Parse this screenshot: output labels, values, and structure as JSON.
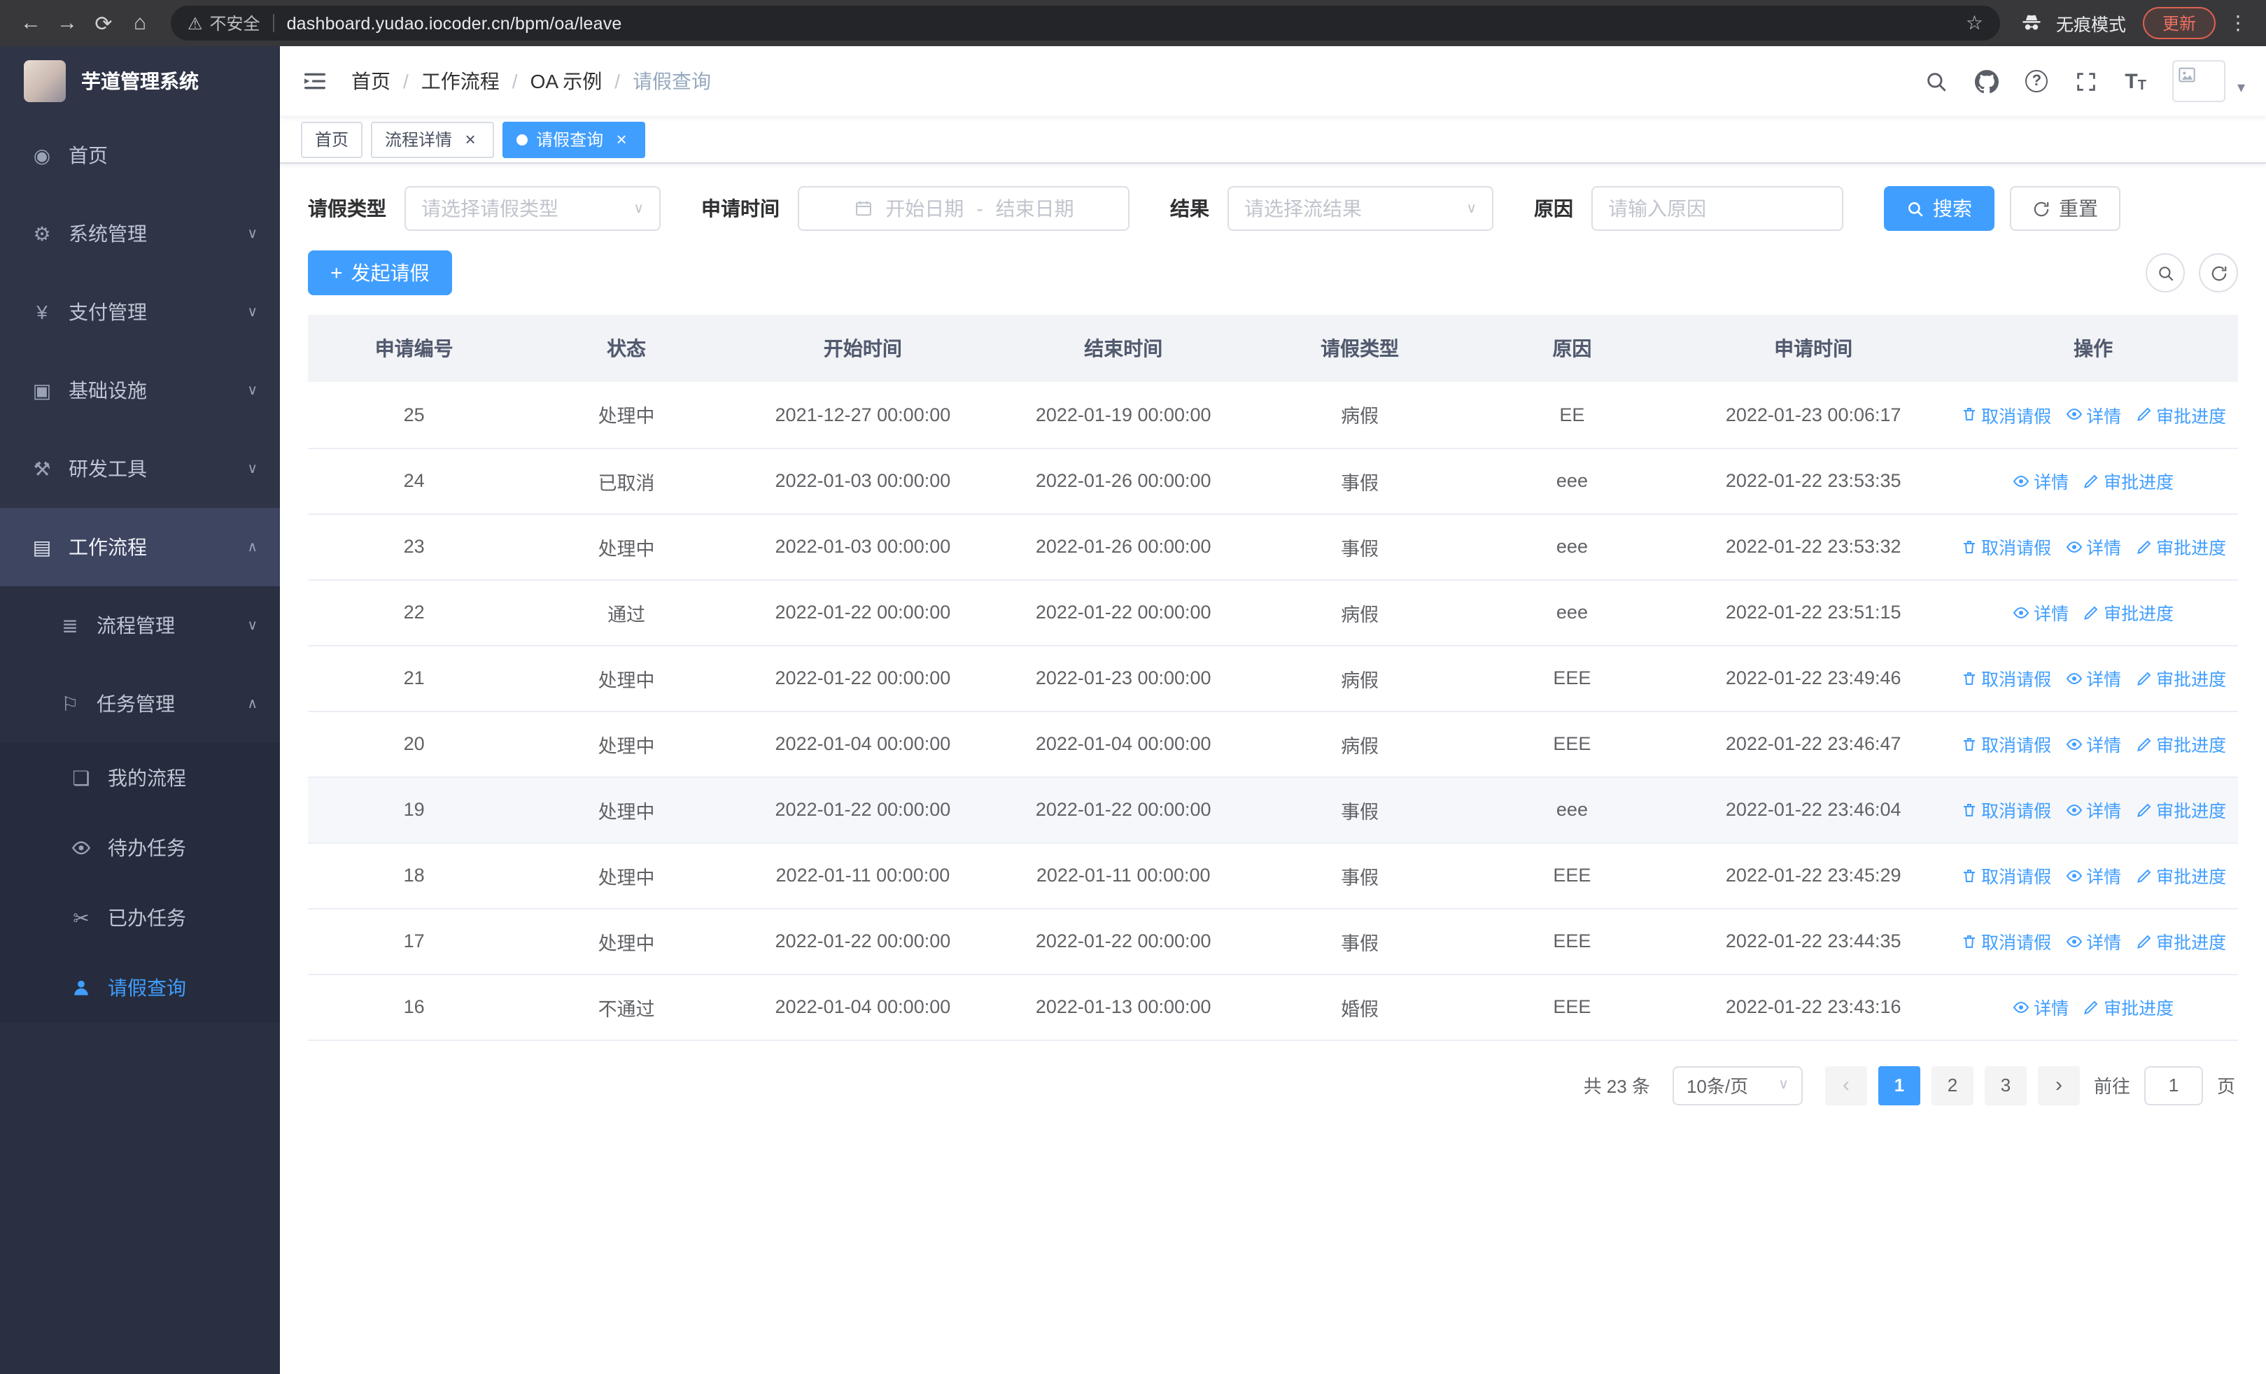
{
  "colors": {
    "accent": "#409eff",
    "sidebar_bg": "#2f3447",
    "update_red": "#e0604f"
  },
  "browser": {
    "security_label": "不安全",
    "url": "dashboard.yudao.iocoder.cn/bpm/oa/leave",
    "incognito_label": "无痕模式",
    "update_label": "更新"
  },
  "sidebar": {
    "title": "芋道管理系统",
    "menu": [
      {
        "id": "home",
        "label": "首页",
        "icon": "dashboard-icon",
        "level": 1
      },
      {
        "id": "system-management",
        "label": "系统管理",
        "icon": "gear-icon",
        "level": 1,
        "arrow": "down"
      },
      {
        "id": "payment-management",
        "label": "支付管理",
        "icon": "yen-icon",
        "level": 1,
        "arrow": "down"
      },
      {
        "id": "infrastructure",
        "label": "基础设施",
        "icon": "infra-icon",
        "level": 1,
        "arrow": "down"
      },
      {
        "id": "dev-tools",
        "label": "研发工具",
        "icon": "tools-icon",
        "level": 1,
        "arrow": "down"
      },
      {
        "id": "workflow",
        "label": "工作流程",
        "icon": "workflow-icon",
        "level": 1,
        "arrow": "up",
        "highlight": true
      },
      {
        "id": "process-management",
        "label": "流程管理",
        "icon": "process-icon",
        "level": 2,
        "arrow": "down"
      },
      {
        "id": "task-management",
        "label": "任务管理",
        "icon": "task-icon",
        "level": 2,
        "arrow": "up"
      },
      {
        "id": "my-process",
        "label": "我的流程",
        "icon": "chat-icon",
        "level": 3
      },
      {
        "id": "todo-tasks",
        "label": "待办任务",
        "icon": "eye-icon",
        "level": 3
      },
      {
        "id": "done-tasks",
        "label": "已办任务",
        "icon": "scissors-icon",
        "level": 3
      },
      {
        "id": "leave-query",
        "label": "请假查询",
        "icon": "user-icon",
        "level": 3,
        "active": true
      }
    ]
  },
  "navbar": {
    "breadcrumb": [
      "首页",
      "工作流程",
      "OA 示例",
      "请假查询"
    ]
  },
  "tabs": [
    {
      "id": "home",
      "label": "首页",
      "closable": false,
      "active": false
    },
    {
      "id": "process-detail",
      "label": "流程详情",
      "closable": true,
      "active": false
    },
    {
      "id": "leave-query",
      "label": "请假查询",
      "closable": true,
      "active": true
    }
  ],
  "filters": {
    "leave_type_label": "请假类型",
    "leave_type_placeholder": "请选择请假类型",
    "apply_time_label": "申请时间",
    "start_date_placeholder": "开始日期",
    "date_separator": "-",
    "end_date_placeholder": "结束日期",
    "result_label": "结果",
    "result_placeholder": "请选择流结果",
    "reason_label": "原因",
    "reason_placeholder": "请输入原因",
    "search_button": "搜索",
    "reset_button": "重置"
  },
  "toolbar": {
    "create_button": "发起请假"
  },
  "table": {
    "columns": [
      "申请编号",
      "状态",
      "开始时间",
      "结束时间",
      "请假类型",
      "原因",
      "申请时间",
      "操作"
    ],
    "action_labels": {
      "cancel": "取消请假",
      "detail": "详情",
      "progress": "审批进度"
    },
    "rows": [
      {
        "id": "25",
        "status": "处理中",
        "start": "2021-12-27 00:00:00",
        "end": "2022-01-19 00:00:00",
        "type": "病假",
        "reason": "EE",
        "applied": "2022-01-23 00:06:17",
        "actions": [
          "cancel",
          "detail",
          "progress"
        ]
      },
      {
        "id": "24",
        "status": "已取消",
        "start": "2022-01-03 00:00:00",
        "end": "2022-01-26 00:00:00",
        "type": "事假",
        "reason": "eee",
        "applied": "2022-01-22 23:53:35",
        "actions": [
          "detail",
          "progress"
        ]
      },
      {
        "id": "23",
        "status": "处理中",
        "start": "2022-01-03 00:00:00",
        "end": "2022-01-26 00:00:00",
        "type": "事假",
        "reason": "eee",
        "applied": "2022-01-22 23:53:32",
        "actions": [
          "cancel",
          "detail",
          "progress"
        ]
      },
      {
        "id": "22",
        "status": "通过",
        "start": "2022-01-22 00:00:00",
        "end": "2022-01-22 00:00:00",
        "type": "病假",
        "reason": "eee",
        "applied": "2022-01-22 23:51:15",
        "actions": [
          "detail",
          "progress"
        ]
      },
      {
        "id": "21",
        "status": "处理中",
        "start": "2022-01-22 00:00:00",
        "end": "2022-01-23 00:00:00",
        "type": "病假",
        "reason": "EEE",
        "applied": "2022-01-22 23:49:46",
        "actions": [
          "cancel",
          "detail",
          "progress"
        ]
      },
      {
        "id": "20",
        "status": "处理中",
        "start": "2022-01-04 00:00:00",
        "end": "2022-01-04 00:00:00",
        "type": "病假",
        "reason": "EEE",
        "applied": "2022-01-22 23:46:47",
        "actions": [
          "cancel",
          "detail",
          "progress"
        ]
      },
      {
        "id": "19",
        "status": "处理中",
        "start": "2022-01-22 00:00:00",
        "end": "2022-01-22 00:00:00",
        "type": "事假",
        "reason": "eee",
        "applied": "2022-01-22 23:46:04",
        "actions": [
          "cancel",
          "detail",
          "progress"
        ],
        "hover": true
      },
      {
        "id": "18",
        "status": "处理中",
        "start": "2022-01-11 00:00:00",
        "end": "2022-01-11 00:00:00",
        "type": "事假",
        "reason": "EEE",
        "applied": "2022-01-22 23:45:29",
        "actions": [
          "cancel",
          "detail",
          "progress"
        ]
      },
      {
        "id": "17",
        "status": "处理中",
        "start": "2022-01-22 00:00:00",
        "end": "2022-01-22 00:00:00",
        "type": "事假",
        "reason": "EEE",
        "applied": "2022-01-22 23:44:35",
        "actions": [
          "cancel",
          "detail",
          "progress"
        ]
      },
      {
        "id": "16",
        "status": "不通过",
        "start": "2022-01-04 00:00:00",
        "end": "2022-01-13 00:00:00",
        "type": "婚假",
        "reason": "EEE",
        "applied": "2022-01-22 23:43:16",
        "actions": [
          "detail",
          "progress"
        ]
      }
    ]
  },
  "pagination": {
    "total": "共 23 条",
    "page_size": "10条/页",
    "pages": [
      "1",
      "2",
      "3"
    ],
    "active_page": "1",
    "goto_label": "前往",
    "goto_value": "1",
    "page_label": "页"
  }
}
